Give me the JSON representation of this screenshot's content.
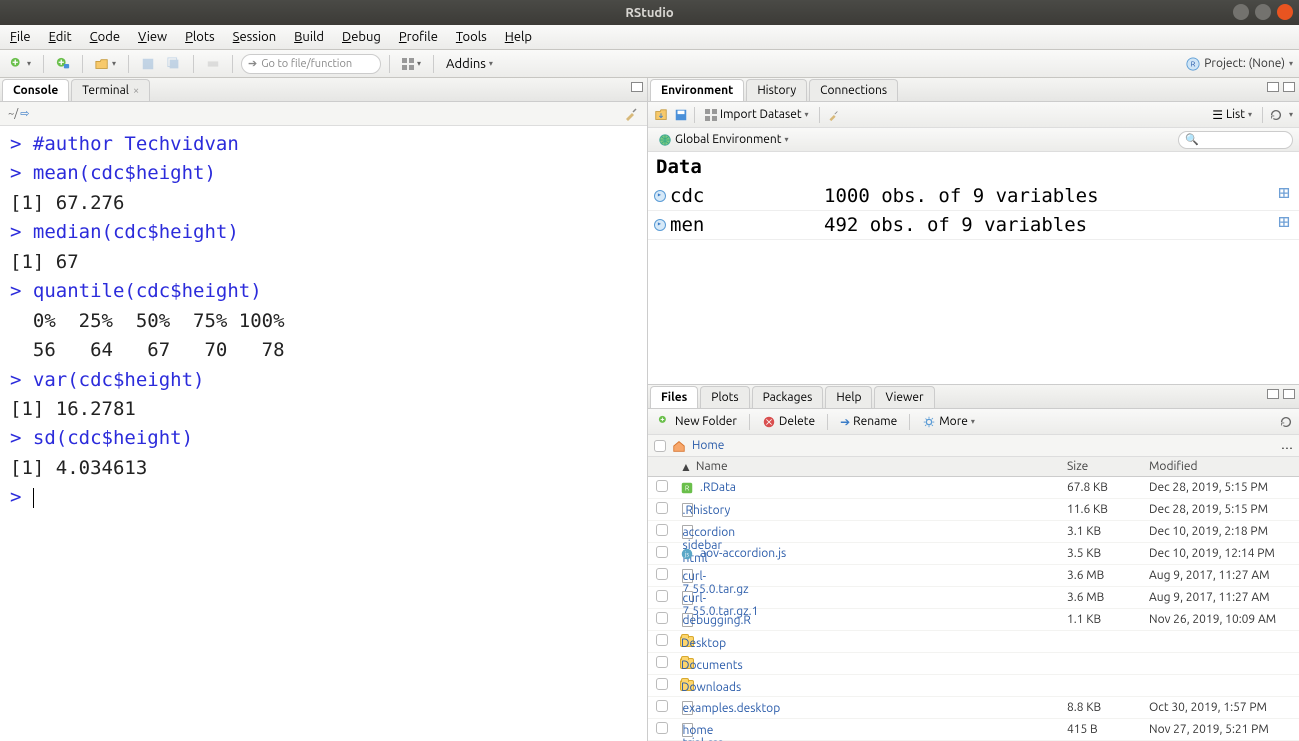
{
  "titlebar": {
    "title": "RStudio"
  },
  "menubar": {
    "file": "File",
    "edit": "Edit",
    "code": "Code",
    "view": "View",
    "plots": "Plots",
    "session": "Session",
    "build": "Build",
    "debug": "Debug",
    "profile": "Profile",
    "tools": "Tools",
    "help": "Help"
  },
  "toolbar": {
    "search_placeholder": "Go to file/function",
    "addins": "Addins",
    "project_label": "Project: (None)"
  },
  "left_pane": {
    "tabs": {
      "console": "Console",
      "terminal": "Terminal"
    },
    "path": "~/",
    "console_lines": [
      {
        "t": "in",
        "text": "#author Techvidvan"
      },
      {
        "t": "in",
        "text": "mean(cdc$height)"
      },
      {
        "t": "out",
        "text": "[1] 67.276"
      },
      {
        "t": "in",
        "text": "median(cdc$height)"
      },
      {
        "t": "out",
        "text": "[1] 67"
      },
      {
        "t": "in",
        "text": "quantile(cdc$height)"
      },
      {
        "t": "out",
        "text": "  0%  25%  50%  75% 100% "
      },
      {
        "t": "out",
        "text": "  56   64   67   70   78 "
      },
      {
        "t": "in",
        "text": "var(cdc$height)"
      },
      {
        "t": "out",
        "text": "[1] 16.2781"
      },
      {
        "t": "in",
        "text": "sd(cdc$height)"
      },
      {
        "t": "out",
        "text": "[1] 4.034613"
      },
      {
        "t": "prompt",
        "text": ""
      }
    ]
  },
  "env_pane": {
    "tabs": {
      "environment": "Environment",
      "history": "History",
      "connections": "Connections"
    },
    "toolbar": {
      "import": "Import Dataset",
      "scope": "Global Environment",
      "view": "List"
    },
    "section": "Data",
    "items": [
      {
        "name": "cdc",
        "desc": "1000 obs. of 9 variables"
      },
      {
        "name": "men",
        "desc": "492 obs. of 9 variables"
      }
    ]
  },
  "files_pane": {
    "tabs": {
      "files": "Files",
      "plots": "Plots",
      "packages": "Packages",
      "help": "Help",
      "viewer": "Viewer"
    },
    "toolbar": {
      "new_folder": "New Folder",
      "delete": "Delete",
      "rename": "Rename",
      "more": "More"
    },
    "path_home": "Home",
    "headers": {
      "name": "Name",
      "size": "Size",
      "modified": "Modified"
    },
    "files": [
      {
        "icon": "rdata",
        "name": ".RData",
        "size": "67.8 KB",
        "mod": "Dec 28, 2019, 5:15 PM"
      },
      {
        "icon": "doc",
        "name": ".Rhistory",
        "size": "11.6 KB",
        "mod": "Dec 28, 2019, 5:15 PM"
      },
      {
        "icon": "doc",
        "name": "accordion sidebar html",
        "size": "3.1 KB",
        "mod": "Dec 10, 2019, 2:18 PM"
      },
      {
        "icon": "js",
        "name": "aov-accordion.js",
        "size": "3.5 KB",
        "mod": "Dec 10, 2019, 12:14 PM"
      },
      {
        "icon": "doc",
        "name": "curl-7.55.0.tar.gz",
        "size": "3.6 MB",
        "mod": "Aug 9, 2017, 11:27 AM"
      },
      {
        "icon": "doc",
        "name": "curl-7.55.0.tar.gz.1",
        "size": "3.6 MB",
        "mod": "Aug 9, 2017, 11:27 AM"
      },
      {
        "icon": "doc",
        "name": "debugging.R",
        "size": "1.1 KB",
        "mod": "Nov 26, 2019, 10:09 AM"
      },
      {
        "icon": "folder",
        "name": "Desktop",
        "size": "",
        "mod": ""
      },
      {
        "icon": "folder",
        "name": "Documents",
        "size": "",
        "mod": ""
      },
      {
        "icon": "folder",
        "name": "Downloads",
        "size": "",
        "mod": ""
      },
      {
        "icon": "doc",
        "name": "examples.desktop",
        "size": "8.8 KB",
        "mod": "Oct 30, 2019, 1:57 PM"
      },
      {
        "icon": "doc",
        "name": "home trial.css",
        "size": "415 B",
        "mod": "Nov 27, 2019, 5:21 PM"
      }
    ]
  }
}
